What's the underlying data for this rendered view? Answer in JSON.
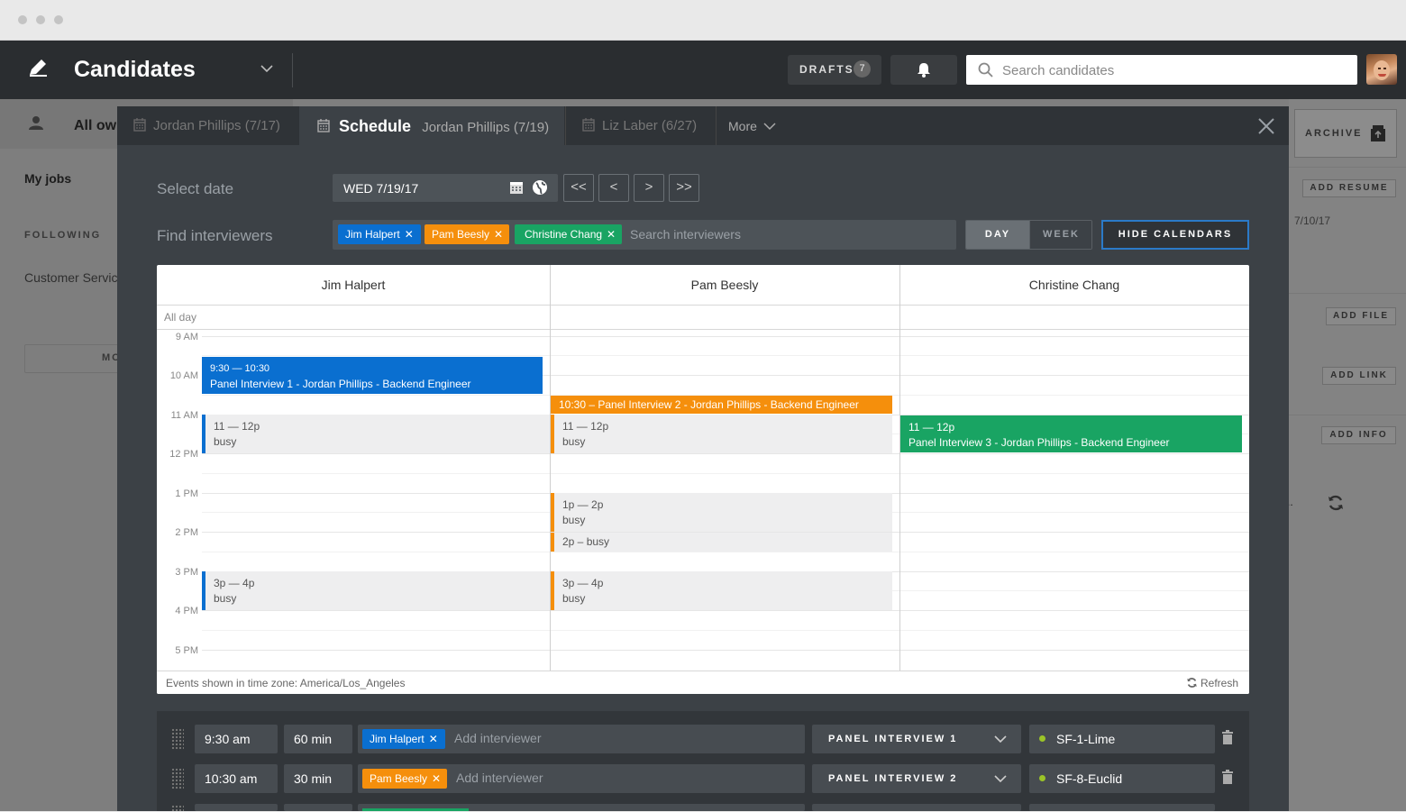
{
  "header": {
    "title": "Candidates",
    "drafts_label": "DRAFTS",
    "drafts_count": "7",
    "search_placeholder": "Search candidates"
  },
  "background": {
    "left": {
      "all_owners": "All own",
      "my_jobs": "My jobs",
      "following": "FOLLOWING",
      "customer_service": "Customer Servic",
      "more": "MO"
    },
    "right": {
      "archive": "ARCHIVE",
      "add_resume": "ADD RESUME",
      "date": "7/10/17",
      "add_file": "ADD FILE",
      "add_link": "ADD LINK",
      "add_info": "ADD INFO",
      "ellipsis": ".."
    }
  },
  "tabs": [
    {
      "label": "Jordan Phillips (7/17)"
    },
    {
      "label": "Schedule",
      "sub": "Jordan Phillips (7/19)"
    },
    {
      "label": "Liz Laber (6/27)"
    },
    {
      "label": "More"
    }
  ],
  "form": {
    "select_date_label": "Select date",
    "date_value": "WED 7/19/17",
    "nav": [
      "<<",
      "<",
      ">",
      ">>"
    ],
    "find_interviewers_label": "Find interviewers",
    "interviewers": [
      {
        "name": "Jim Halpert",
        "color": "#0a6fd0"
      },
      {
        "name": "Pam Beesly",
        "color": "#f58f0c"
      },
      {
        "name": "Christine Chang",
        "color": "#19a463"
      }
    ],
    "search_interviewers_placeholder": "Search interviewers",
    "view_day": "DAY",
    "view_week": "WEEK",
    "hide_calendars": "HIDE CALENDARS"
  },
  "calendar": {
    "columns": [
      "Jim Halpert",
      "Pam Beesly",
      "Christine Chang"
    ],
    "all_day": "All day",
    "times": [
      "9 AM",
      "10 AM",
      "11 AM",
      "12 PM",
      "1 PM",
      "2 PM",
      "3 PM",
      "4 PM",
      "5 PM"
    ],
    "events": {
      "jim_panel_time": "9:30 — 10:30",
      "jim_panel_title": "Panel Interview 1 - Jordan Phillips - Backend Engineer",
      "jim_busy1_time": "11 — 12p",
      "jim_busy1_label": "busy",
      "jim_busy2_time": "3p — 4p",
      "jim_busy2_label": "busy",
      "pam_panel_title": "10:30 – Panel Interview 2 - Jordan Phillips - Backend Engineer",
      "pam_busy1_time": "11 — 12p",
      "pam_busy1_label": "busy",
      "pam_busy2_time": "1p — 2p",
      "pam_busy2_label": "busy",
      "pam_busy3_label": "2p – busy",
      "pam_busy4_time": "3p — 4p",
      "pam_busy4_label": "busy",
      "chris_panel_time": "11 — 12p",
      "chris_panel_title": "Panel Interview 3 - Jordan Phillips - Backend Engineer"
    },
    "timezone_note": "Events shown in time zone: America/Los_Angeles",
    "refresh": "Refresh"
  },
  "schedule_rows": [
    {
      "time": "9:30 am",
      "duration": "60 min",
      "interviewer": "Jim Halpert",
      "add_placeholder": "Add interviewer",
      "type": "PANEL INTERVIEW 1",
      "room": "SF-1-Lime"
    },
    {
      "time": "10:30 am",
      "duration": "30 min",
      "interviewer": "Pam Beesly",
      "add_placeholder": "Add interviewer",
      "type": "PANEL INTERVIEW 2",
      "room": "SF-8-Euclid"
    }
  ],
  "colors": {
    "blue": "#0a6fd0",
    "orange": "#f58f0c",
    "green": "#19a463",
    "room_dot": "#9bc428"
  }
}
